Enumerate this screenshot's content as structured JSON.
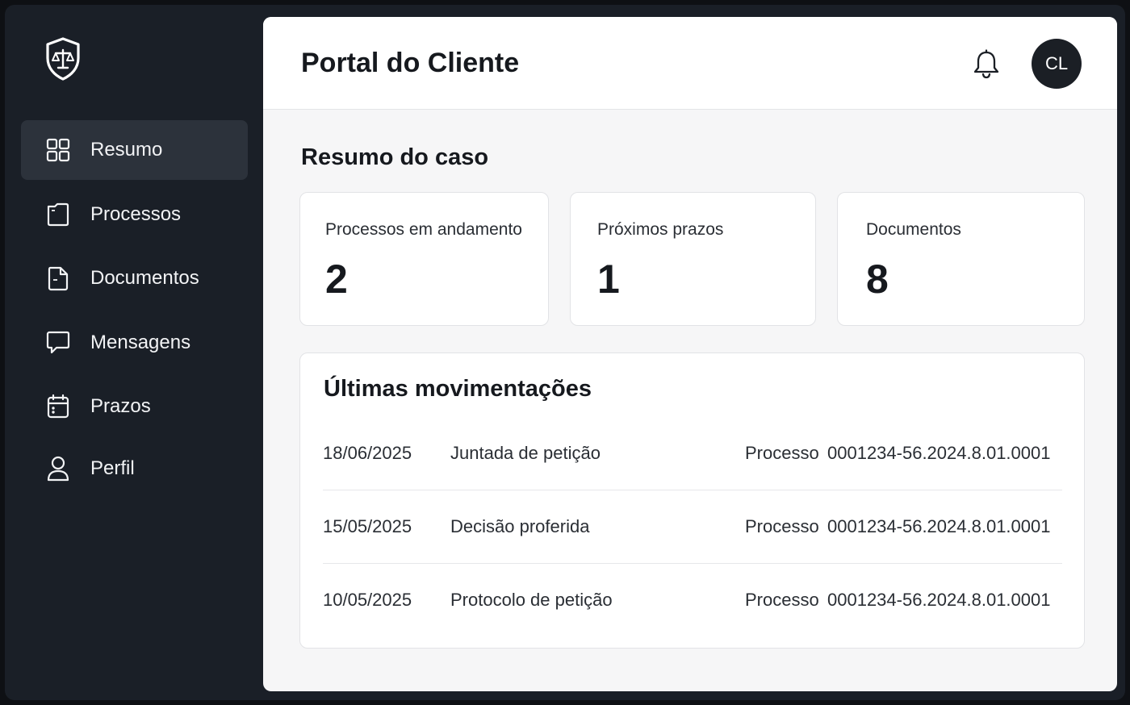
{
  "sidebar": {
    "items": [
      {
        "label": "Resumo",
        "icon": "grid-icon",
        "active": true
      },
      {
        "label": "Processos",
        "icon": "folder-icon"
      },
      {
        "label": "Documentos",
        "icon": "document-icon"
      },
      {
        "label": "Mensagens",
        "icon": "chat-icon"
      },
      {
        "label": "Prazos",
        "icon": "calendar-icon"
      },
      {
        "label": "Perfil",
        "icon": "user-icon"
      }
    ]
  },
  "header": {
    "title": "Portal do Cliente",
    "avatar_initials": "CL"
  },
  "summary": {
    "title": "Resumo do caso",
    "cards": [
      {
        "label": "Processos em andamento",
        "value": "2"
      },
      {
        "label": "Próximos prazos",
        "value": "1"
      },
      {
        "label": "Documentos",
        "value": "8"
      }
    ]
  },
  "activity": {
    "title": "Últimas movimentações",
    "rows": [
      {
        "date": "18/06/2025",
        "event": "Juntada de petição",
        "process_label": "Processo",
        "process_number": "0001234-56.2024.8.01.0001"
      },
      {
        "date": "15/05/2025",
        "event": "Decisão proferida",
        "process_label": "Processo",
        "process_number": "0001234-56.2024.8.01.0001"
      },
      {
        "date": "10/05/2025",
        "event": "Protocolo de petição",
        "process_label": "Processo",
        "process_number": "0001234-56.2024.8.01.0001"
      }
    ]
  },
  "colors": {
    "sidebar_bg": "#1a1f27",
    "active_item_bg": "#2c323b",
    "main_bg": "#f6f6f7",
    "text_dark": "#16191e"
  }
}
